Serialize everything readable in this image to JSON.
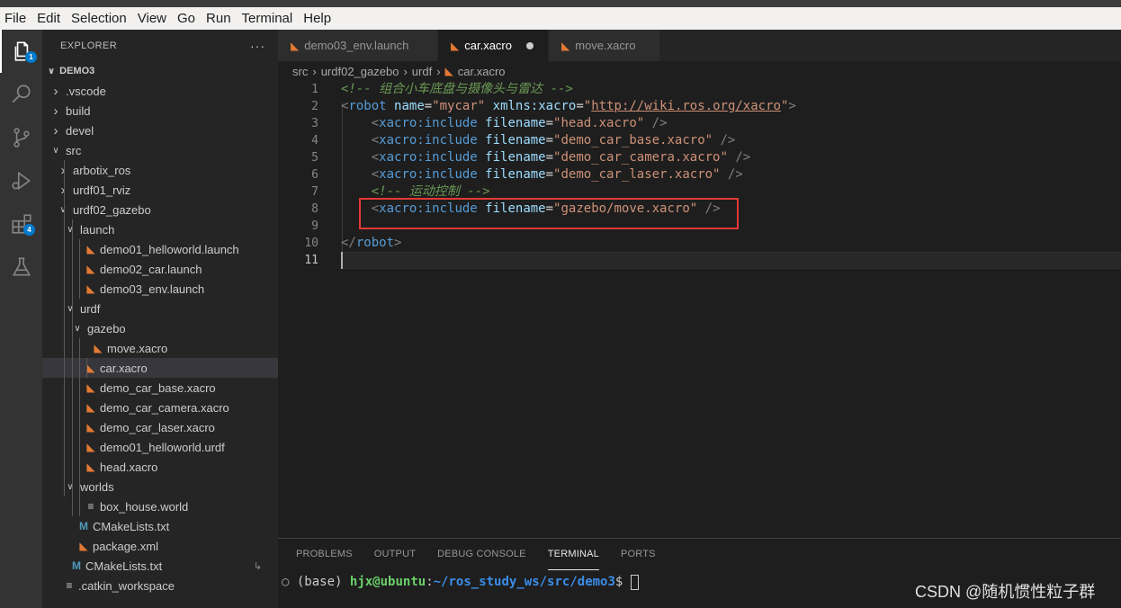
{
  "menubar": {
    "items": [
      "File",
      "Edit",
      "Selection",
      "View",
      "Go",
      "Run",
      "Terminal",
      "Help"
    ]
  },
  "activitybar": {
    "items": [
      {
        "icon": "files-icon",
        "badge": "1"
      },
      {
        "icon": "search-icon",
        "badge": ""
      },
      {
        "icon": "source-control-icon",
        "badge": ""
      },
      {
        "icon": "run-debug-icon",
        "badge": ""
      },
      {
        "icon": "extensions-icon",
        "badge": "4"
      },
      {
        "icon": "testing-flask-icon",
        "badge": ""
      }
    ]
  },
  "sidebar": {
    "title": "EXPLORER",
    "more": "···",
    "section": "DEMO3",
    "tree": [
      {
        "label": ".vscode",
        "type": "folder",
        "open": false,
        "depth": 1
      },
      {
        "label": "build",
        "type": "folder",
        "open": false,
        "depth": 1
      },
      {
        "label": "devel",
        "type": "folder",
        "open": false,
        "depth": 1
      },
      {
        "label": "src",
        "type": "folder",
        "open": true,
        "depth": 1
      },
      {
        "label": "arbotix_ros",
        "type": "folder",
        "open": false,
        "depth": 2
      },
      {
        "label": "urdf01_rviz",
        "type": "folder",
        "open": false,
        "depth": 2
      },
      {
        "label": "urdf02_gazebo",
        "type": "folder",
        "open": true,
        "depth": 2
      },
      {
        "label": "launch",
        "type": "folder",
        "open": true,
        "depth": 3
      },
      {
        "label": "demo01_helloworld.launch",
        "type": "rss",
        "depth": 4
      },
      {
        "label": "demo02_car.launch",
        "type": "rss",
        "depth": 4
      },
      {
        "label": "demo03_env.launch",
        "type": "rss",
        "depth": 4
      },
      {
        "label": "urdf",
        "type": "folder",
        "open": true,
        "depth": 3
      },
      {
        "label": "gazebo",
        "type": "folder",
        "open": true,
        "depth": 4
      },
      {
        "label": "move.xacro",
        "type": "rss",
        "depth": 5
      },
      {
        "label": "car.xacro",
        "type": "rss",
        "depth": 4,
        "selected": true
      },
      {
        "label": "demo_car_base.xacro",
        "type": "rss",
        "depth": 4
      },
      {
        "label": "demo_car_camera.xacro",
        "type": "rss",
        "depth": 4
      },
      {
        "label": "demo_car_laser.xacro",
        "type": "rss",
        "depth": 4
      },
      {
        "label": "demo01_helloworld.urdf",
        "type": "rss",
        "depth": 4
      },
      {
        "label": "head.xacro",
        "type": "rss",
        "depth": 4
      },
      {
        "label": "worlds",
        "type": "folder",
        "open": true,
        "depth": 3
      },
      {
        "label": "box_house.world",
        "type": "eq",
        "depth": 4
      },
      {
        "label": "CMakeLists.txt",
        "type": "m",
        "depth": 3
      },
      {
        "label": "package.xml",
        "type": "rss",
        "depth": 3
      },
      {
        "label": "CMakeLists.txt",
        "type": "m",
        "depth": 2,
        "extra": "↳"
      },
      {
        "label": ".catkin_workspace",
        "type": "eq",
        "depth": 1
      }
    ]
  },
  "tabs": [
    {
      "label": "demo03_env.launch",
      "active": false,
      "dirty": false
    },
    {
      "label": "car.xacro",
      "active": true,
      "dirty": true
    },
    {
      "label": "move.xacro",
      "active": false,
      "dirty": false
    }
  ],
  "breadcrumb": [
    "src",
    "urdf02_gazebo",
    "urdf",
    "car.xacro"
  ],
  "editor": {
    "line_numbers": [
      "1",
      "2",
      "3",
      "4",
      "5",
      "6",
      "7",
      "8",
      "9",
      "10",
      "11"
    ],
    "lines": [
      {
        "indent": "",
        "parts": [
          [
            "c-com",
            "<!-- 组合小车底盘与摄像头与雷达 -->"
          ]
        ]
      },
      {
        "indent": "",
        "parts": [
          [
            "c-punc",
            "<"
          ],
          [
            "c-tag",
            "robot"
          ],
          [
            "c-txt",
            " "
          ],
          [
            "c-attr",
            "name"
          ],
          [
            "c-txt",
            "="
          ],
          [
            "c-str",
            "\"mycar\""
          ],
          [
            "c-txt",
            " "
          ],
          [
            "c-attr",
            "xmlns:xacro"
          ],
          [
            "c-txt",
            "="
          ],
          [
            "c-str",
            "\""
          ],
          [
            "c-link",
            "http://wiki.ros.org/xacro"
          ],
          [
            "c-str",
            "\""
          ],
          [
            "c-punc",
            ">"
          ]
        ]
      },
      {
        "indent": "    ",
        "parts": [
          [
            "c-punc",
            "<"
          ],
          [
            "c-tag",
            "xacro:include"
          ],
          [
            "c-txt",
            " "
          ],
          [
            "c-attr",
            "filename"
          ],
          [
            "c-txt",
            "="
          ],
          [
            "c-str",
            "\"head.xacro\""
          ],
          [
            "c-txt",
            " "
          ],
          [
            "c-punc",
            "/>"
          ]
        ]
      },
      {
        "indent": "    ",
        "parts": [
          [
            "c-punc",
            "<"
          ],
          [
            "c-tag",
            "xacro:include"
          ],
          [
            "c-txt",
            " "
          ],
          [
            "c-attr",
            "filename"
          ],
          [
            "c-txt",
            "="
          ],
          [
            "c-str",
            "\"demo_car_base.xacro\""
          ],
          [
            "c-txt",
            " "
          ],
          [
            "c-punc",
            "/>"
          ]
        ]
      },
      {
        "indent": "    ",
        "parts": [
          [
            "c-punc",
            "<"
          ],
          [
            "c-tag",
            "xacro:include"
          ],
          [
            "c-txt",
            " "
          ],
          [
            "c-attr",
            "filename"
          ],
          [
            "c-txt",
            "="
          ],
          [
            "c-str",
            "\"demo_car_camera.xacro\""
          ],
          [
            "c-txt",
            " "
          ],
          [
            "c-punc",
            "/>"
          ]
        ]
      },
      {
        "indent": "    ",
        "parts": [
          [
            "c-punc",
            "<"
          ],
          [
            "c-tag",
            "xacro:include"
          ],
          [
            "c-txt",
            " "
          ],
          [
            "c-attr",
            "filename"
          ],
          [
            "c-txt",
            "="
          ],
          [
            "c-str",
            "\"demo_car_laser.xacro\""
          ],
          [
            "c-txt",
            " "
          ],
          [
            "c-punc",
            "/>"
          ]
        ]
      },
      {
        "indent": "    ",
        "parts": [
          [
            "c-com",
            "<!-- 运动控制 -->"
          ]
        ]
      },
      {
        "indent": "    ",
        "parts": [
          [
            "c-punc",
            "<"
          ],
          [
            "c-tag",
            "xacro:include"
          ],
          [
            "c-txt",
            " "
          ],
          [
            "c-attr",
            "filename"
          ],
          [
            "c-txt",
            "="
          ],
          [
            "c-str",
            "\"gazebo/move.xacro\""
          ],
          [
            "c-txt",
            " "
          ],
          [
            "c-punc",
            "/>"
          ]
        ]
      },
      {
        "indent": "",
        "parts": []
      },
      {
        "indent": "",
        "parts": [
          [
            "c-punc",
            "</"
          ],
          [
            "c-tag",
            "robot"
          ],
          [
            "c-punc",
            ">"
          ]
        ]
      },
      {
        "indent": "",
        "parts": []
      }
    ]
  },
  "panel": {
    "tabs": [
      "PROBLEMS",
      "OUTPUT",
      "DEBUG CONSOLE",
      "TERMINAL",
      "PORTS"
    ],
    "active_tab": "TERMINAL",
    "terminal": {
      "circle": "○",
      "env": "(base)",
      "user": "hjx@ubuntu",
      "colon": ":",
      "path": "~/ros_study_ws/src/demo3",
      "prompt": "$"
    }
  },
  "watermark": "CSDN @随机惯性粒子群"
}
